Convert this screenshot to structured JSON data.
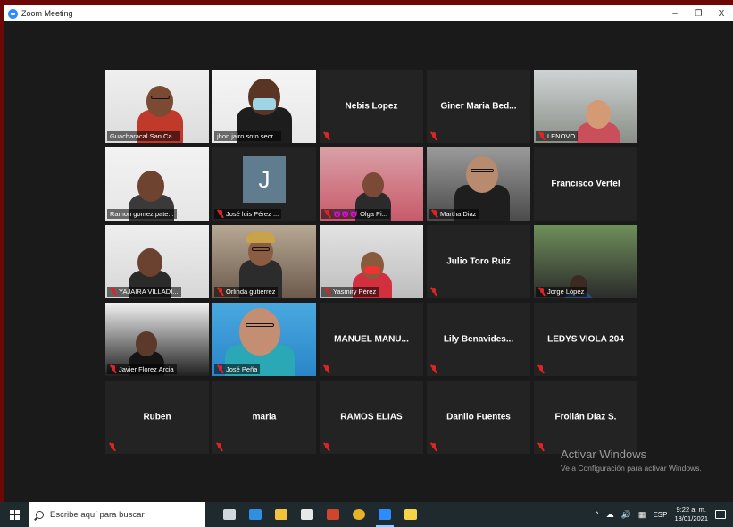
{
  "window": {
    "title": "Zoom Meeting",
    "minimize": "–",
    "restore": "❐",
    "close": "X"
  },
  "tiles": [
    {
      "id": "t1",
      "label": "Guacharacal San Ca...",
      "muted": false,
      "type": "video"
    },
    {
      "id": "t2",
      "label": "jhon jairo soto secr...",
      "muted": false,
      "type": "video"
    },
    {
      "id": "t3",
      "name": "Nebis Lopez",
      "muted": true,
      "type": "name"
    },
    {
      "id": "t4",
      "name": "Giner Maria Bed...",
      "muted": true,
      "type": "name"
    },
    {
      "id": "t5",
      "label": "LENOVO",
      "muted": true,
      "type": "video"
    },
    {
      "id": "t6",
      "label": "Ramon gomez pate...",
      "muted": false,
      "type": "video"
    },
    {
      "id": "t7",
      "label": "José luis Pérez ...",
      "muted": true,
      "type": "avatar",
      "initial": "J"
    },
    {
      "id": "t8",
      "label": "😈😈😈 Olga Pi...",
      "muted": true,
      "type": "video"
    },
    {
      "id": "t9",
      "label": "Martha Diaz",
      "muted": true,
      "type": "video"
    },
    {
      "id": "t10",
      "name": "Francisco Vertel",
      "muted": false,
      "type": "name"
    },
    {
      "id": "t11",
      "label": "YAJAIRA VILLADI...",
      "muted": true,
      "type": "video"
    },
    {
      "id": "t12",
      "label": "Orlinda gutierrez",
      "muted": true,
      "type": "video"
    },
    {
      "id": "t13",
      "label": "Yasmiry Pérez",
      "muted": true,
      "type": "video"
    },
    {
      "id": "t14",
      "name": "Julio Toro Ruiz",
      "muted": true,
      "type": "name"
    },
    {
      "id": "t15",
      "label": "Jorge López",
      "muted": true,
      "type": "video"
    },
    {
      "id": "t16",
      "label": "Javier Florez Arcia",
      "muted": true,
      "type": "video"
    },
    {
      "id": "t17",
      "label": "José Peña",
      "muted": true,
      "type": "video"
    },
    {
      "id": "t18",
      "name": "MANUEL MANU...",
      "muted": true,
      "type": "name"
    },
    {
      "id": "t19",
      "name": "Lily Benavides...",
      "muted": true,
      "type": "name"
    },
    {
      "id": "t20",
      "name": "LEDYS VIOLA 204",
      "muted": true,
      "type": "name"
    },
    {
      "id": "t21",
      "name": "Ruben",
      "muted": true,
      "type": "name"
    },
    {
      "id": "t22",
      "name": "maria",
      "muted": true,
      "type": "name"
    },
    {
      "id": "t23",
      "name": "RAMOS ELIAS",
      "muted": true,
      "type": "name"
    },
    {
      "id": "t24",
      "name": "Danilo Fuentes",
      "muted": true,
      "type": "name"
    },
    {
      "id": "t25",
      "name": "Froilán Díaz S.",
      "muted": true,
      "type": "name"
    }
  ],
  "watermark": {
    "line1": "Activar Windows",
    "line2": "Ve a Configuración para activar Windows."
  },
  "taskbar": {
    "search_placeholder": "Escribe aquí para buscar",
    "apps": [
      "task-view-icon",
      "mail-icon",
      "file-explorer-icon",
      "store-icon",
      "powerpoint-icon",
      "chrome-icon",
      "zoom-icon",
      "sticky-notes-icon"
    ],
    "tray_lang": "ESP",
    "tray_chevron": "^",
    "time": "9:22 a. m.",
    "date": "18/01/2021"
  }
}
